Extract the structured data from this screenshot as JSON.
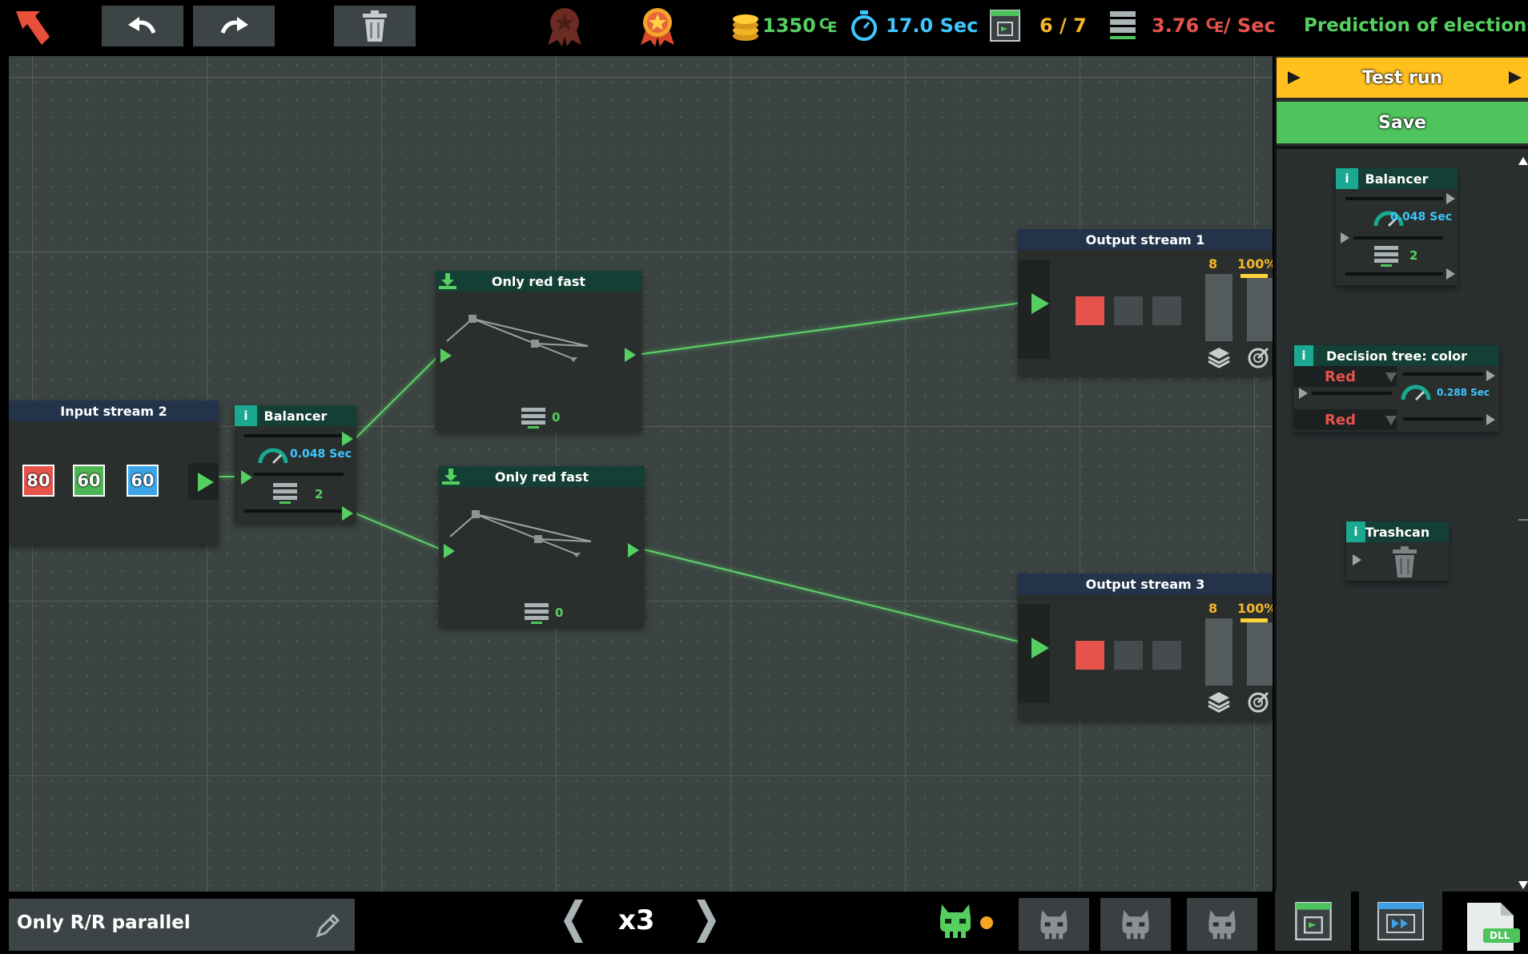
{
  "topbar": {
    "coins": "1350",
    "currency_symbol": "₠",
    "time": "17.0 Sec",
    "progress": "6 / 7",
    "rate": "3.76 ₠/ Sec",
    "level_title": "Prediction of elections",
    "icons": [
      "back-arrow-icon",
      "undo-icon",
      "redo-icon",
      "trash-icon",
      "medal-icon",
      "medal-icon",
      "coins-icon",
      "stopwatch-icon",
      "exit-icon",
      "server-icon"
    ]
  },
  "canvas": {
    "input_stream": {
      "title": "Input stream 2",
      "values": [
        "80",
        "60",
        "60"
      ],
      "colors": [
        "#e5534b",
        "#4db554",
        "#3aa6e8"
      ]
    },
    "balancer": {
      "title": "Balancer",
      "badge": "i",
      "speed": "0.048 Sec",
      "count": "2"
    },
    "filter_a": {
      "title": "Only red fast",
      "count": "0"
    },
    "filter_b": {
      "title": "Only red fast",
      "count": "0"
    },
    "output_1": {
      "title": "Output stream 1",
      "count": "8",
      "percent": "100%"
    },
    "output_3": {
      "title": "Output stream 3",
      "count": "8",
      "percent": "100%"
    }
  },
  "panel": {
    "test_run_label": "Test run",
    "save_label": "Save",
    "balancer": {
      "title": "Balancer",
      "badge": "i",
      "speed": "0.048 Sec",
      "count": "2"
    },
    "decision_tree": {
      "title": "Decision tree: color",
      "badge": "i",
      "option_top": "Red",
      "option_bottom": "Red",
      "speed": "0.288 Sec"
    },
    "trashcan": {
      "title": "Trashcan",
      "badge": "i"
    }
  },
  "bottombar": {
    "solution_name": "Only R/R parallel",
    "speed": "x3",
    "dll_label": "DLL"
  },
  "colors": {
    "accent_green": "#55d060",
    "accent_yellow": "#f5b72a",
    "accent_cyan": "#3fc7ff",
    "accent_red": "#e5534b",
    "test_run_bg": "#ffc01e",
    "save_bg": "#4fc45c"
  }
}
